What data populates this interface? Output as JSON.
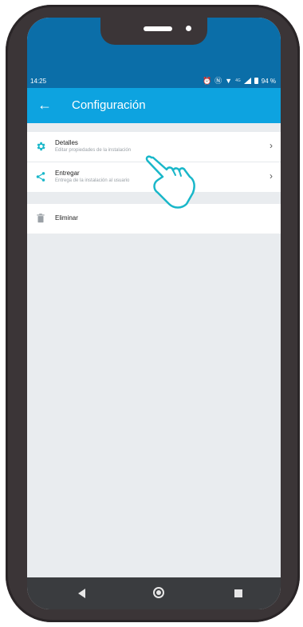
{
  "status_bar": {
    "time": "14:25",
    "network": "4G",
    "battery": "94 %"
  },
  "app_bar": {
    "title": "Configuración",
    "back_icon": "arrow-left-icon"
  },
  "settings": {
    "items": [
      {
        "title": "Detalles",
        "subtitle": "Editar propiedades de la instalación",
        "icon": "gear-icon"
      },
      {
        "title": "Entregar",
        "subtitle": "Entrega de la instalación al usuario",
        "icon": "share-icon"
      }
    ],
    "delete": {
      "title": "Eliminar",
      "icon": "trash-icon"
    }
  },
  "colors": {
    "app_bar": "#0da3e0",
    "status_bar": "#0b6ea8",
    "accent": "#19b7c9",
    "background": "#e9ecef"
  }
}
